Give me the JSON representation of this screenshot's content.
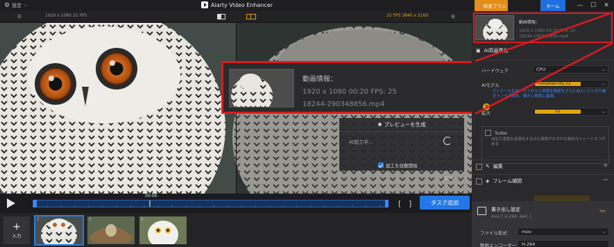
{
  "titlebar": {
    "settings_label": "設定",
    "app_title": "Aiarty Video Enhancer",
    "plan_label": "料金プラン",
    "home_label": "ホーム",
    "min": "—",
    "max": "☐",
    "close": "✕"
  },
  "preview_header": {
    "before_label": "前",
    "before_info": "1920 x 1080  25 FPS",
    "after_info": "25 FPS  3840 x 2160",
    "after_label": "後"
  },
  "info": {
    "title": "動画情報：",
    "res_line": "1920 x 1080  00:20    FPS: 25",
    "filename": "18244-290348856.mp4"
  },
  "process": {
    "generate_label": "プレビューを生成",
    "status": "AI加工中...",
    "autostart_label": "加工を自動開始"
  },
  "zoom": {
    "value": "22%"
  },
  "timeline": {
    "time": "00:06",
    "add_task_label": "タスク追加",
    "bracket_l": "[",
    "bracket_r": "]"
  },
  "thumbbar": {
    "add_label": "入力",
    "info_mark": "i"
  },
  "right": {
    "info_title": "動画情報：",
    "info_res": "1920 x 1080  00:20    FPS: 25",
    "info_file": "18244-290348856.mp4",
    "ai_section": "AI高画質化",
    "hardware_label": "ハードウェア",
    "hardware_value": "CPU",
    "ai_model_label": "AIモデル",
    "ai_model_value": "moDetail-HQ  v2",
    "ai_note": "ディテール生成、ピクセルと質感を精度をさらに向上! ピンボケ補正＋ノイズ除去、細かい質感に最適。",
    "scale_label": "拡大",
    "scale_value": "x2",
    "turbo_label": "Turbo",
    "turbo_desc": "AI加工速度を高速化するほど画質がわずかな損失のトレードオフがある",
    "edit_label": "編集",
    "frame_label": "フレーム補間",
    "export_title": "書き出し設定",
    "export_sub": "mov [ H.264, AAC ]",
    "file_format_label": "ファイル形式",
    "file_format_value": "mov",
    "video_codec_label": "動画エンコーダー",
    "video_codec_value": "H.264"
  },
  "colors": {
    "accent_blue": "#2477e6",
    "accent_orange": "#e48e14",
    "highlight_red": "#e0191f",
    "gold": "#e1a414"
  }
}
